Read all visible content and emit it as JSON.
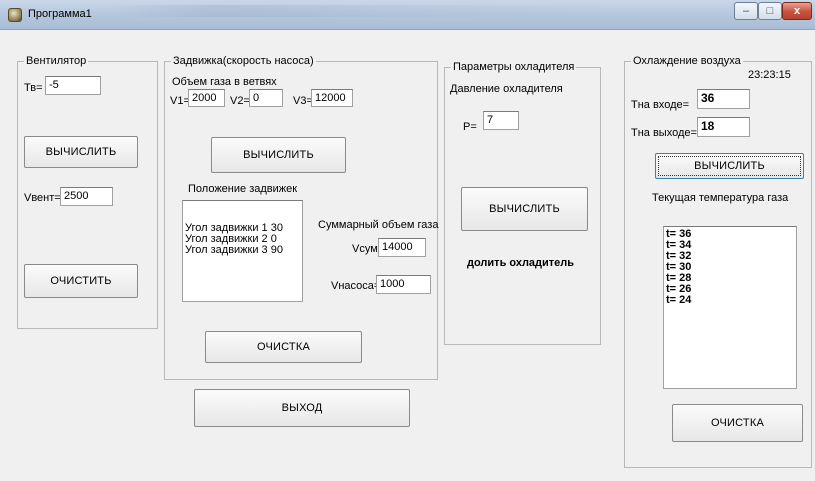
{
  "window": {
    "title": "Программа1",
    "controls": {
      "minimize": "–",
      "maximize": "□",
      "close": "x"
    }
  },
  "fan": {
    "legend": "Вентилятор",
    "tv_label": "Тв=",
    "tv_value": "-5",
    "calc_button": "ВЫЧИСЛИТЬ",
    "vvent_label": "Vвент=",
    "vvent_value": "2500",
    "clear_button": "ОЧИСТИТЬ"
  },
  "valve": {
    "legend": "Задвижка(скорость насоса)",
    "gas_volume_label": "Объем газа в ветвях",
    "v1_label": "V1=",
    "v1_value": "2000",
    "v2_label": "V2=",
    "v2_value": "0",
    "v3_label": "V3=",
    "v3_value": "12000",
    "calc_button": "ВЫЧИСЛИТЬ",
    "positions_label": "Положение задвижек",
    "positions": [
      "Угол задвижки 1  30",
      "Угол задвижки 2  0",
      "Угол задвижки 3  90"
    ],
    "total_volume_label": "Суммарный объем газа",
    "vsum_label": "Vсум=",
    "vsum_value": "14000",
    "vpump_label": "Vнасоса=",
    "vpump_value": "1000",
    "clear_button": "ОЧИСТКА"
  },
  "exit_button": "ВЫХОД",
  "coolant": {
    "legend": "Параметры охладителя",
    "pressure_label": "Давление охладителя",
    "p_label": "P=",
    "p_value": "7",
    "calc_button": "ВЫЧИСЛИТЬ",
    "message": "долить охладитель"
  },
  "air": {
    "legend": "Охлаждение воздуха",
    "time": "23:23:15",
    "t_in_label": "Тна входе=",
    "t_in_value": "36",
    "t_out_label": "Тна выходе=",
    "t_out_value": "18",
    "calc_button": "ВЫЧИСЛИТЬ",
    "current_temp_label": "Текущая температура газа",
    "temps": [
      "t= 36",
      "t= 34",
      "t= 32",
      "t= 30",
      "t= 28",
      "t= 26",
      "t= 24"
    ],
    "clear_button": "ОЧИСТКА"
  }
}
